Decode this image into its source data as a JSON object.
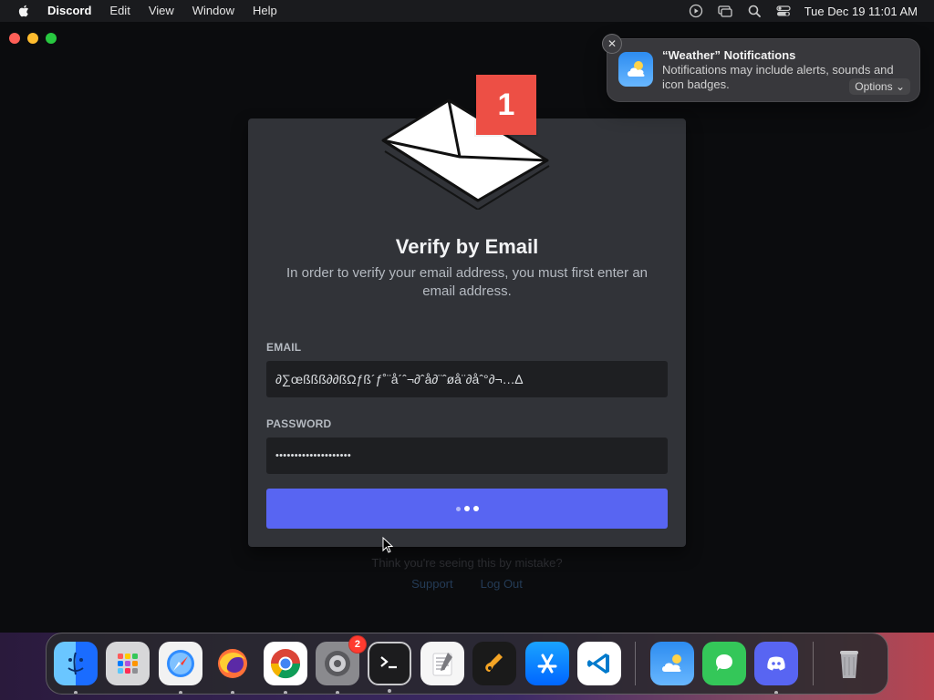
{
  "menubar": {
    "app_name": "Discord",
    "items": [
      "Edit",
      "View",
      "Window",
      "Help"
    ],
    "clock": "Tue Dec 19  11:01 AM"
  },
  "notification": {
    "title": "“Weather” Notifications",
    "body": "Notifications may include alerts, sounds and icon badges.",
    "options_label": "Options"
  },
  "verify": {
    "badge": "1",
    "title": "Verify by Email",
    "subtitle": "In order to verify your email address, you must first enter an email address.",
    "email_label": "EMAIL",
    "email_value": "∂∑œßßß∂∂ßΩƒß´ƒ˚¨å´ˆ¬∂ˆå∂¨ˆøå¨∂åˆ°∂¬…∆",
    "password_label": "PASSWORD",
    "password_value": "••••••••••••••••••••",
    "button_state": "loading"
  },
  "under": {
    "text": "Think you're seeing this by mistake?",
    "link1": "Support",
    "link2": "Log Out"
  },
  "dock": {
    "items": [
      {
        "name": "Finder"
      },
      {
        "name": "Launchpad"
      },
      {
        "name": "Safari"
      },
      {
        "name": "Firefox"
      },
      {
        "name": "Chrome"
      },
      {
        "name": "System Settings",
        "badge": "2"
      },
      {
        "name": "Terminal"
      },
      {
        "name": "TextEdit"
      },
      {
        "name": "GarageBand"
      },
      {
        "name": "App Store"
      },
      {
        "name": "Visual Studio Code"
      },
      {
        "name": "Weather"
      },
      {
        "name": "Messages"
      },
      {
        "name": "Discord"
      },
      {
        "name": "Trash"
      }
    ]
  },
  "colors": {
    "discord_blurple": "#5865f2",
    "card_bg": "#313338",
    "badge_red": "#ed4f45"
  }
}
